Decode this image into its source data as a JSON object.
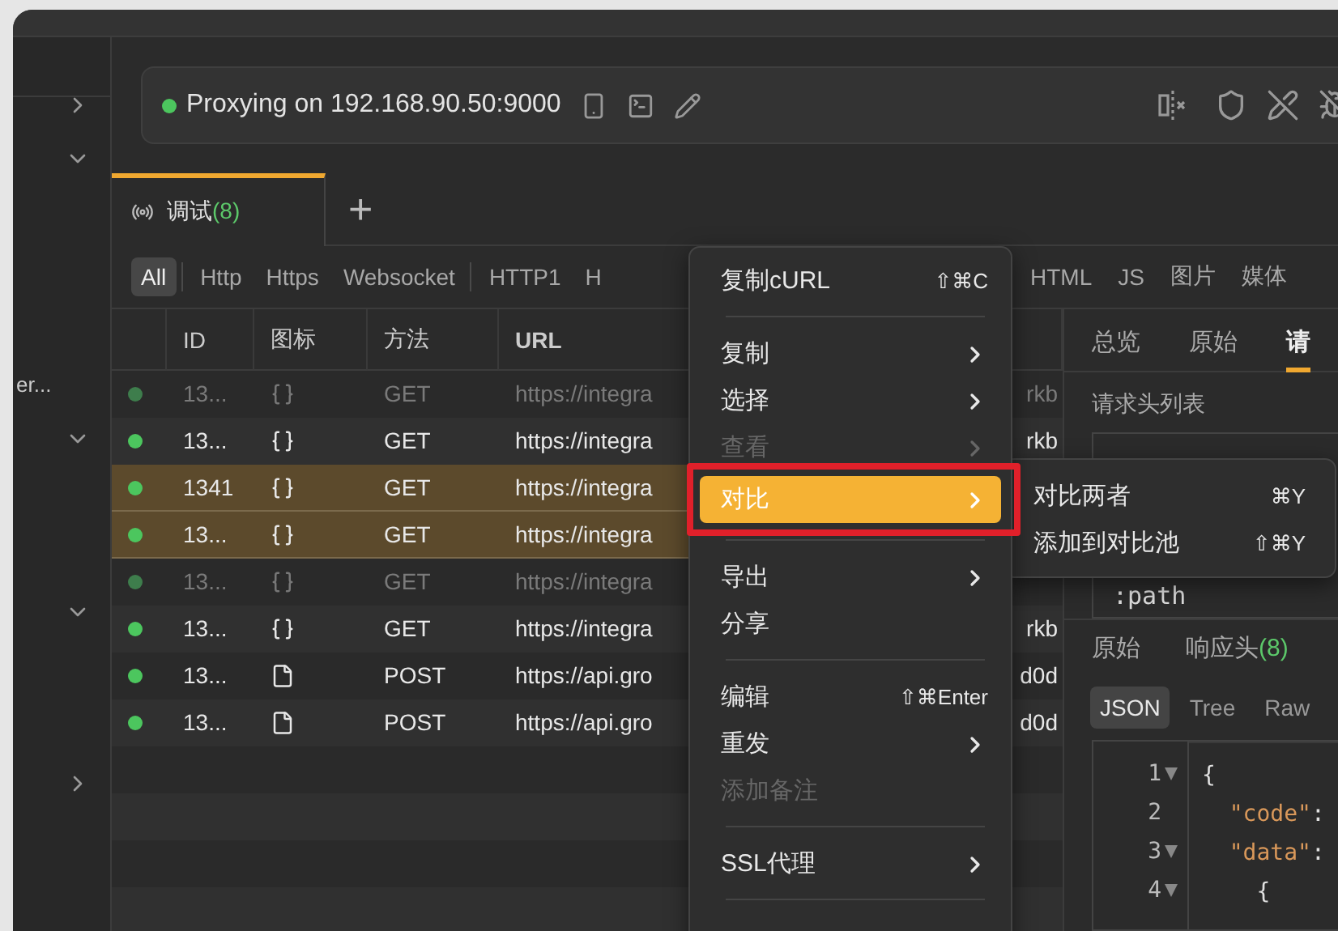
{
  "sidebar": {
    "items": [
      {
        "kind": "chevron",
        "expanded": false
      },
      {
        "kind": "chevron",
        "expanded": true
      },
      {
        "kind": "label",
        "label": "er..."
      },
      {
        "kind": "chevron",
        "expanded": true
      },
      {
        "kind": "chevron",
        "expanded": true
      },
      {
        "kind": "chevron",
        "expanded": false
      }
    ]
  },
  "proxy": {
    "status": "Proxying on 192.168.90.50:9000",
    "running": true
  },
  "session_tabs": [
    {
      "label": "调试",
      "count": "(8)",
      "selected": true
    }
  ],
  "add_tab": "+",
  "filters": [
    {
      "kind": "filter",
      "label": "All",
      "selected": true
    },
    {
      "kind": "separator"
    },
    {
      "kind": "filter",
      "label": "Http",
      "selected": false
    },
    {
      "kind": "filter",
      "label": "Https",
      "selected": false
    },
    {
      "kind": "filter",
      "label": "Websocket",
      "selected": false
    },
    {
      "kind": "separator"
    },
    {
      "kind": "filter",
      "label": "HTTP1",
      "selected": false
    },
    {
      "kind": "filter",
      "label": "H",
      "selected": false
    }
  ],
  "filters_right": [
    {
      "label": "HTML",
      "selected": false
    },
    {
      "label": "JS",
      "selected": false
    },
    {
      "label": "图片",
      "selected": false
    },
    {
      "label": "媒体",
      "selected": false
    }
  ],
  "table": {
    "columns": [
      "ID",
      "图标",
      "方法",
      "URL"
    ],
    "rows": [
      {
        "id": "13...",
        "kind": "json",
        "method": "GET",
        "url": "https://integra",
        "url_tail": "rkb",
        "dimmed": true,
        "selected": false
      },
      {
        "id": "13...",
        "kind": "json",
        "method": "GET",
        "url": "https://integra",
        "url_tail": "rkb",
        "dimmed": false,
        "selected": false
      },
      {
        "id": "1341",
        "kind": "json",
        "method": "GET",
        "url": "https://integra",
        "dimmed": false,
        "selected": true
      },
      {
        "id": "13...",
        "kind": "json",
        "method": "GET",
        "url": "https://integra",
        "dimmed": false,
        "selected": true
      },
      {
        "id": "13...",
        "kind": "json",
        "method": "GET",
        "url": "https://integra",
        "dimmed": true,
        "selected": false
      },
      {
        "id": "13...",
        "kind": "json",
        "method": "GET",
        "url": "https://integra",
        "url_tail": "rkb",
        "dimmed": false,
        "selected": false
      },
      {
        "id": "13...",
        "kind": "file",
        "method": "POST",
        "url": "https://api.gro",
        "url_tail": "d0d",
        "dimmed": false,
        "selected": false
      },
      {
        "id": "13...",
        "kind": "file",
        "method": "POST",
        "url": "https://api.gro",
        "url_tail": "d0d",
        "dimmed": false,
        "selected": false
      }
    ]
  },
  "detail": {
    "tabs": [
      {
        "label": "总览",
        "selected": false
      },
      {
        "label": "原始",
        "selected": false
      },
      {
        "label": "请",
        "selected": true
      }
    ],
    "section_title": "请求头列表",
    "header_name": ":path",
    "response_tabs": [
      {
        "label": "原始"
      },
      {
        "label": "响应头",
        "count": "(8)"
      }
    ],
    "formats": [
      {
        "label": "JSON",
        "selected": true
      },
      {
        "label": "Tree",
        "selected": false
      },
      {
        "label": "Raw",
        "selected": false
      }
    ],
    "code_lines": [
      {
        "number": "1",
        "foldable": true,
        "tokens": [
          {
            "kind": "punct",
            "text": "{"
          }
        ]
      },
      {
        "number": "2",
        "foldable": false,
        "tokens": [
          {
            "kind": "key",
            "text": "  \"code\""
          },
          {
            "kind": "punct",
            "text": ":"
          }
        ]
      },
      {
        "number": "3",
        "foldable": true,
        "tokens": [
          {
            "kind": "key",
            "text": "  \"data\""
          },
          {
            "kind": "punct",
            "text": ":"
          }
        ]
      },
      {
        "number": "4",
        "foldable": true,
        "tokens": [
          {
            "kind": "punct",
            "text": "    {"
          }
        ]
      }
    ]
  },
  "context_menu": {
    "items": [
      {
        "kind": "item",
        "label": "复制cURL",
        "shortcut": "⇧⌘C",
        "submenu": false,
        "disabled": false,
        "selected": false
      },
      {
        "kind": "divider"
      },
      {
        "kind": "item",
        "label": "复制",
        "submenu": true,
        "disabled": false,
        "selected": false
      },
      {
        "kind": "item",
        "label": "选择",
        "submenu": true,
        "disabled": false,
        "selected": false
      },
      {
        "kind": "item",
        "label": "查看",
        "submenu": true,
        "disabled": true,
        "selected": false
      },
      {
        "kind": "item",
        "label": "对比",
        "submenu": true,
        "disabled": false,
        "selected": true,
        "annotated": true
      },
      {
        "kind": "divider"
      },
      {
        "kind": "item",
        "label": "导出",
        "submenu": true,
        "disabled": false,
        "selected": false
      },
      {
        "kind": "item",
        "label": "分享",
        "submenu": false,
        "disabled": false,
        "selected": false
      },
      {
        "kind": "divider"
      },
      {
        "kind": "item",
        "label": "编辑",
        "shortcut": "⇧⌘Enter",
        "submenu": false,
        "disabled": false,
        "selected": false
      },
      {
        "kind": "item",
        "label": "重发",
        "submenu": true,
        "disabled": false,
        "selected": false
      },
      {
        "kind": "item",
        "label": "添加备注",
        "submenu": false,
        "disabled": true,
        "selected": false
      },
      {
        "kind": "divider"
      },
      {
        "kind": "item",
        "label": "SSL代理",
        "submenu": true,
        "disabled": false,
        "selected": false
      },
      {
        "kind": "divider"
      }
    ]
  },
  "submenu": {
    "items": [
      {
        "label": "对比两者",
        "shortcut": "⌘Y"
      },
      {
        "label": "添加到对比池",
        "shortcut": "⇧⌘Y"
      }
    ]
  }
}
